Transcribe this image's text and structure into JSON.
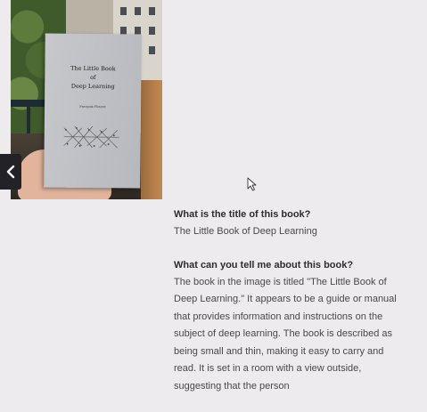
{
  "photo": {
    "book_title_line1": "The Little Book",
    "book_title_line2": "of",
    "book_title_line3": "Deep Learning",
    "book_author": "François Fleuret"
  },
  "navigation": {
    "prev_icon": "chevron-left-icon"
  },
  "qa": [
    {
      "question": "What is the title of this book?",
      "answer": "The Little Book of Deep Learning"
    },
    {
      "question": "What can you tell me about this book?",
      "answer": "The book in the image is titled \"The Little Book of Deep Learning.\" It appears to be a guide or manual that provides information and instructions on the subject of deep learning. The book is described as being small and thin, making it easy to carry and read. It is set in a room with a view outside, suggesting that the person"
    }
  ]
}
